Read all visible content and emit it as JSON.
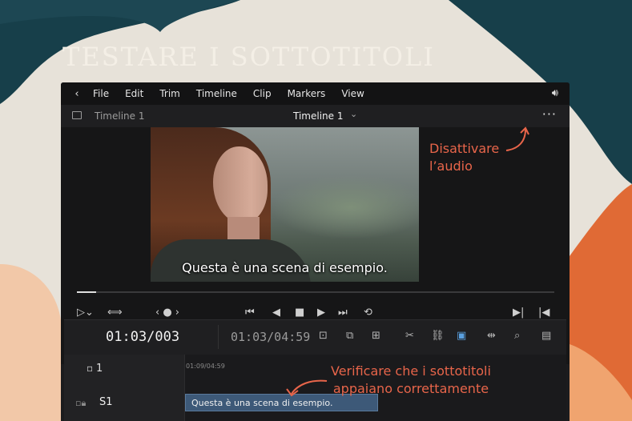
{
  "heading": "TESTARE I SOTTOTITOLI",
  "menu": {
    "back_icon": "chevron-left-icon",
    "items": [
      "File",
      "Edit",
      "Trim",
      "Timeline",
      "Clip",
      "Markers",
      "View"
    ],
    "volume_icon": "speaker-volume-icon"
  },
  "tabbar": {
    "left_tab": "Timeline 1",
    "center_title": "Timeline 1",
    "more_label": "···"
  },
  "viewer": {
    "subtitle_text": "Questa è una scena di esempio.",
    "playhead_progress": 0.04
  },
  "annotations": {
    "mute_line1": "Disattivare",
    "mute_line2": "l’audio",
    "check_line1": "Verificare che i sottotitoli",
    "check_line2": "appaiano correttamente",
    "accent_color": "#e8654a"
  },
  "timeline": {
    "current_timecode": "01:03/003",
    "duration_timecode": "01:03/04:59",
    "ruler_start": "01:09/04:59",
    "video_track_label": "1",
    "subtitle_track_label": "S1",
    "subtitle_clip_text": "Questa è una scena di esempio.",
    "clip_color": "#3d5978"
  }
}
